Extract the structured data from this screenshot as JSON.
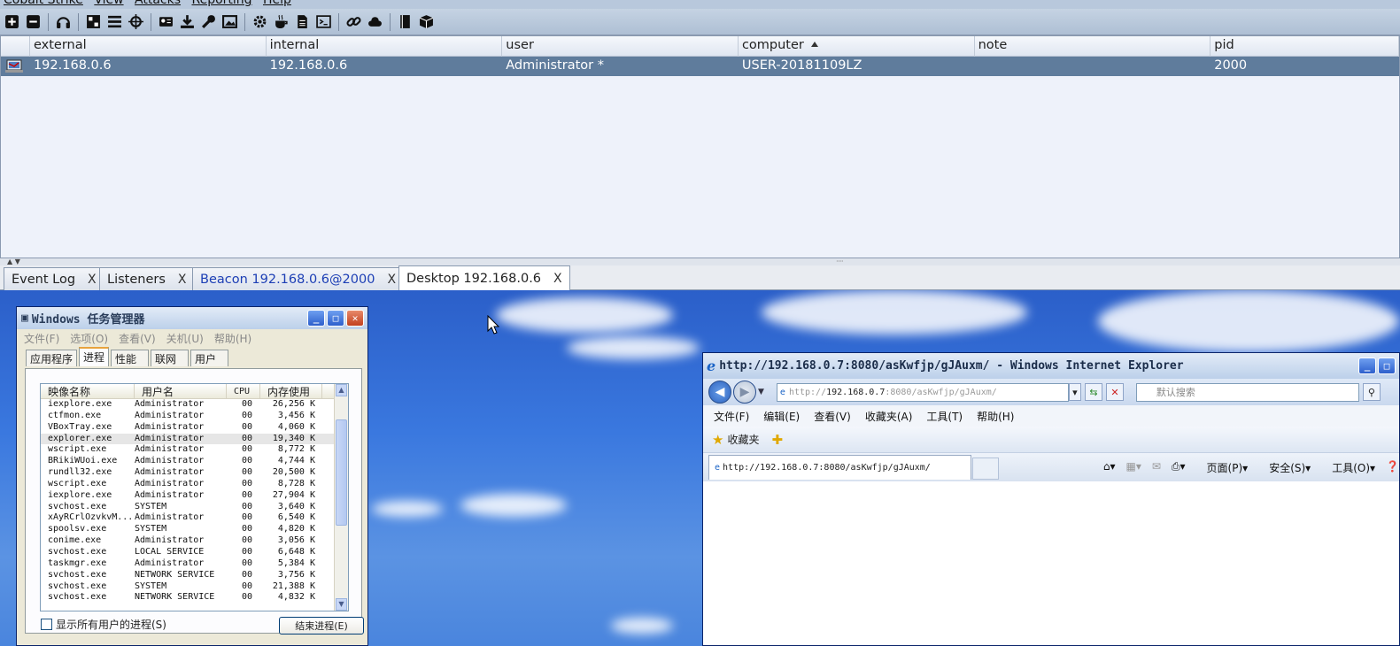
{
  "menubar": [
    "Cobalt Strike",
    "View",
    "Attacks",
    "Reporting",
    "Help"
  ],
  "toolbar_icons": [
    "new-connection-icon",
    "disconnect-icon",
    "listeners-icon",
    "pivot-graph-icon",
    "session-table-icon",
    "targets-icon",
    "credentials-icon",
    "downloaded-files-icon",
    "keystrokes-icon",
    "screenshots-icon",
    "settings-icon",
    "java-payload-icon",
    "console-icon",
    "link-icon",
    "cloud-icon",
    "manual-icon",
    "package-icon"
  ],
  "sessions": {
    "columns": [
      "external",
      "internal",
      "user",
      "computer",
      "note",
      "pid"
    ],
    "sorted_column": "computer",
    "rows": [
      {
        "external": "192.168.0.6",
        "internal": "192.168.0.6",
        "user": "Administrator *",
        "computer": "USER-20181109LZ",
        "note": "",
        "pid": "2000"
      }
    ]
  },
  "tabs": [
    {
      "label": "Event Log",
      "close": "X"
    },
    {
      "label": "Listeners",
      "close": "X"
    },
    {
      "label": "Beacon 192.168.0.6@2000",
      "close": "X"
    },
    {
      "label": "Desktop 192.168.0.6",
      "close": "X"
    }
  ],
  "task_manager": {
    "title": "Windows 任务管理器",
    "menu": [
      "文件(F)",
      "选项(O)",
      "查看(V)",
      "关机(U)",
      "帮助(H)"
    ],
    "tabs": [
      "应用程序",
      "进程",
      "性能",
      "联网",
      "用户"
    ],
    "columns": [
      "映像名称",
      "用户名",
      "CPU",
      "内存使用"
    ],
    "processes": [
      [
        "iexplore.exe",
        "Administrator",
        "00",
        "26,256 K"
      ],
      [
        "ctfmon.exe",
        "Administrator",
        "00",
        "3,456 K"
      ],
      [
        "VBoxTray.exe",
        "Administrator",
        "00",
        "4,060 K"
      ],
      [
        "explorer.exe",
        "Administrator",
        "00",
        "19,340 K"
      ],
      [
        "wscript.exe",
        "Administrator",
        "00",
        "8,772 K"
      ],
      [
        "BRikiWUoi.exe",
        "Administrator",
        "00",
        "4,744 K"
      ],
      [
        "rundll32.exe",
        "Administrator",
        "00",
        "20,500 K"
      ],
      [
        "wscript.exe",
        "Administrator",
        "00",
        "8,728 K"
      ],
      [
        "iexplore.exe",
        "Administrator",
        "00",
        "27,904 K"
      ],
      [
        "svchost.exe",
        "SYSTEM",
        "00",
        "3,640 K"
      ],
      [
        "xAyRCrlOzvkvM...",
        "Administrator",
        "00",
        "6,540 K"
      ],
      [
        "spoolsv.exe",
        "SYSTEM",
        "00",
        "4,820 K"
      ],
      [
        "conime.exe",
        "Administrator",
        "00",
        "3,056 K"
      ],
      [
        "svchost.exe",
        "LOCAL SERVICE",
        "00",
        "6,648 K"
      ],
      [
        "taskmgr.exe",
        "Administrator",
        "00",
        "5,384 K"
      ],
      [
        "svchost.exe",
        "NETWORK SERVICE",
        "00",
        "3,756 K"
      ],
      [
        "svchost.exe",
        "SYSTEM",
        "00",
        "21,388 K"
      ],
      [
        "svchost.exe",
        "NETWORK SERVICE",
        "00",
        "4,832 K"
      ]
    ],
    "show_all_label": "显示所有用户的进程(S)",
    "end_process_label": "结束进程(E)"
  },
  "ie": {
    "title": "http://192.168.0.7:8080/asKwfjp/gJAuxm/ - Windows Internet Explorer",
    "address_prefix": "http://",
    "address_host": "192.168.0.7",
    "address_rest": ":8080/asKwfjp/gJAuxm/",
    "search_placeholder": "默认搜索",
    "menu": [
      "文件(F)",
      "编辑(E)",
      "查看(V)",
      "收藏夹(A)",
      "工具(T)",
      "帮助(H)"
    ],
    "favorites_label": "收藏夹",
    "tab_label": "http://192.168.0.7:8080/asKwfjp/gJAuxm/",
    "commands": [
      "页面(P)",
      "安全(S)",
      "工具(O)"
    ]
  }
}
